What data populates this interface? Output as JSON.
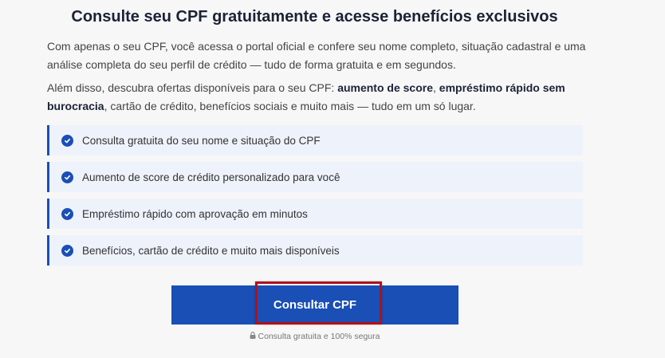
{
  "header": {
    "title": "Consulte seu CPF gratuitamente e acesse benefícios exclusivos"
  },
  "intro": {
    "paragraph1": "Com apenas o seu CPF, você acessa o portal oficial e confere seu nome completo, situação cadastral e uma análise completa do seu perfil de crédito — tudo de forma gratuita e em segundos.",
    "paragraph2_prefix": "Além disso, descubra ofertas disponíveis para o seu CPF: ",
    "paragraph2_bold1": "aumento de score",
    "paragraph2_sep": ", ",
    "paragraph2_bold2": "empréstimo rápido sem burocracia",
    "paragraph2_suffix": ", cartão de crédito, benefícios sociais e muito mais — tudo em um só lugar."
  },
  "features": [
    "Consulta gratuita do seu nome e situação do CPF",
    "Aumento de score de crédito personalizado para você",
    "Empréstimo rápido com aprovação em minutos",
    "Benefícios, cartão de crédito e muito mais disponíveis"
  ],
  "cta": {
    "label": "Consultar CPF",
    "secure_note": "Consulta gratuita e 100% segura"
  },
  "icons": {
    "feature": "check-circle-icon",
    "secure": "lock-icon"
  },
  "colors": {
    "accent": "#1a4fb5",
    "highlight_border": "#b0111a",
    "feature_bg": "#eef2fb",
    "title": "#1b2335"
  }
}
